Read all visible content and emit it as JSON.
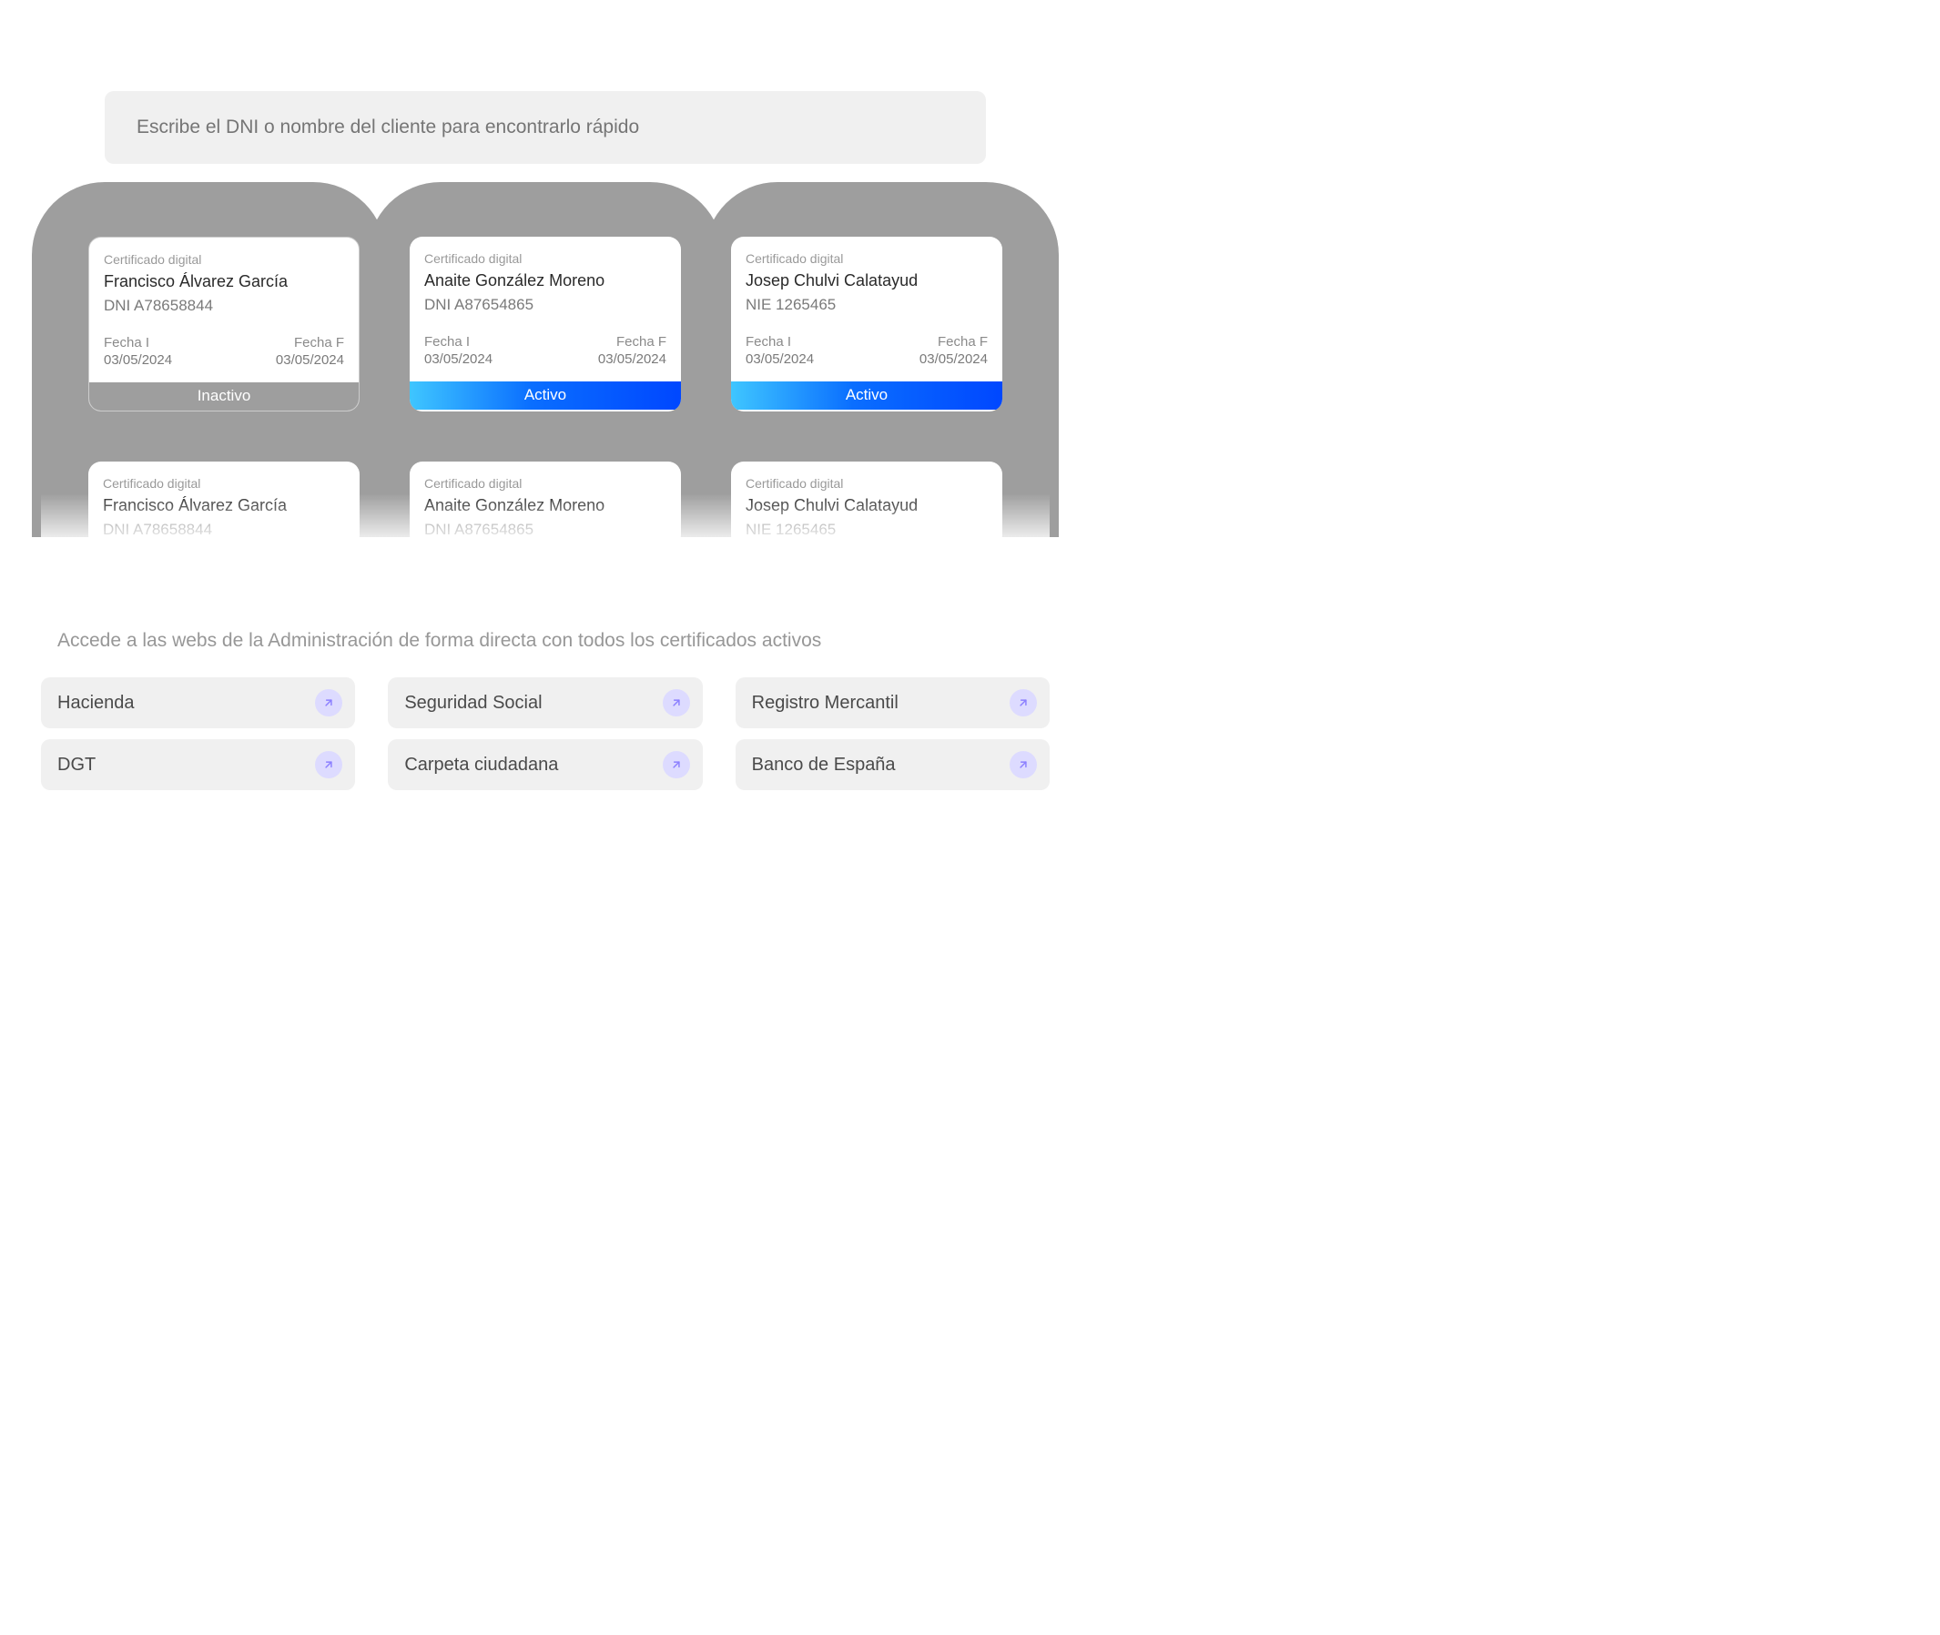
{
  "search": {
    "placeholder": "Escribe el DNI o nombre del cliente para encontrarlo rápido"
  },
  "cards": [
    {
      "subtitle": "Certificado digital",
      "name": "Francisco Álvarez García",
      "id": "DNI A78658844",
      "date_start_label": "Fecha I",
      "date_start": "03/05/2024",
      "date_end_label": "Fecha F",
      "date_end": "03/05/2024",
      "status": "Inactivo"
    },
    {
      "subtitle": "Certificado digital",
      "name": "Anaite González Moreno",
      "id": "DNI A87654865",
      "date_start_label": "Fecha I",
      "date_start": "03/05/2024",
      "date_end_label": "Fecha F",
      "date_end": "03/05/2024",
      "status": "Activo"
    },
    {
      "subtitle": "Certificado digital",
      "name": "Josep Chulvi Calatayud",
      "id": "NIE 1265465",
      "date_start_label": "Fecha I",
      "date_start": "03/05/2024",
      "date_end_label": "Fecha F",
      "date_end": "03/05/2024",
      "status": "Activo"
    },
    {
      "subtitle": "Certificado digital",
      "name": "Francisco Álvarez García",
      "id": "DNI A78658844"
    },
    {
      "subtitle": "Certificado digital",
      "name": "Anaite González Moreno",
      "id": "DNI A87654865"
    },
    {
      "subtitle": "Certificado digital",
      "name": "Josep Chulvi Calatayud",
      "id": "NIE 1265465"
    }
  ],
  "section_description": "Accede a las webs de la Administración de forma directa con todos los certificados activos",
  "links": [
    {
      "label": "Hacienda"
    },
    {
      "label": "Seguridad Social"
    },
    {
      "label": "Registro Mercantil"
    },
    {
      "label": "DGT"
    },
    {
      "label": "Carpeta ciudadana"
    },
    {
      "label": "Banco de España"
    }
  ]
}
